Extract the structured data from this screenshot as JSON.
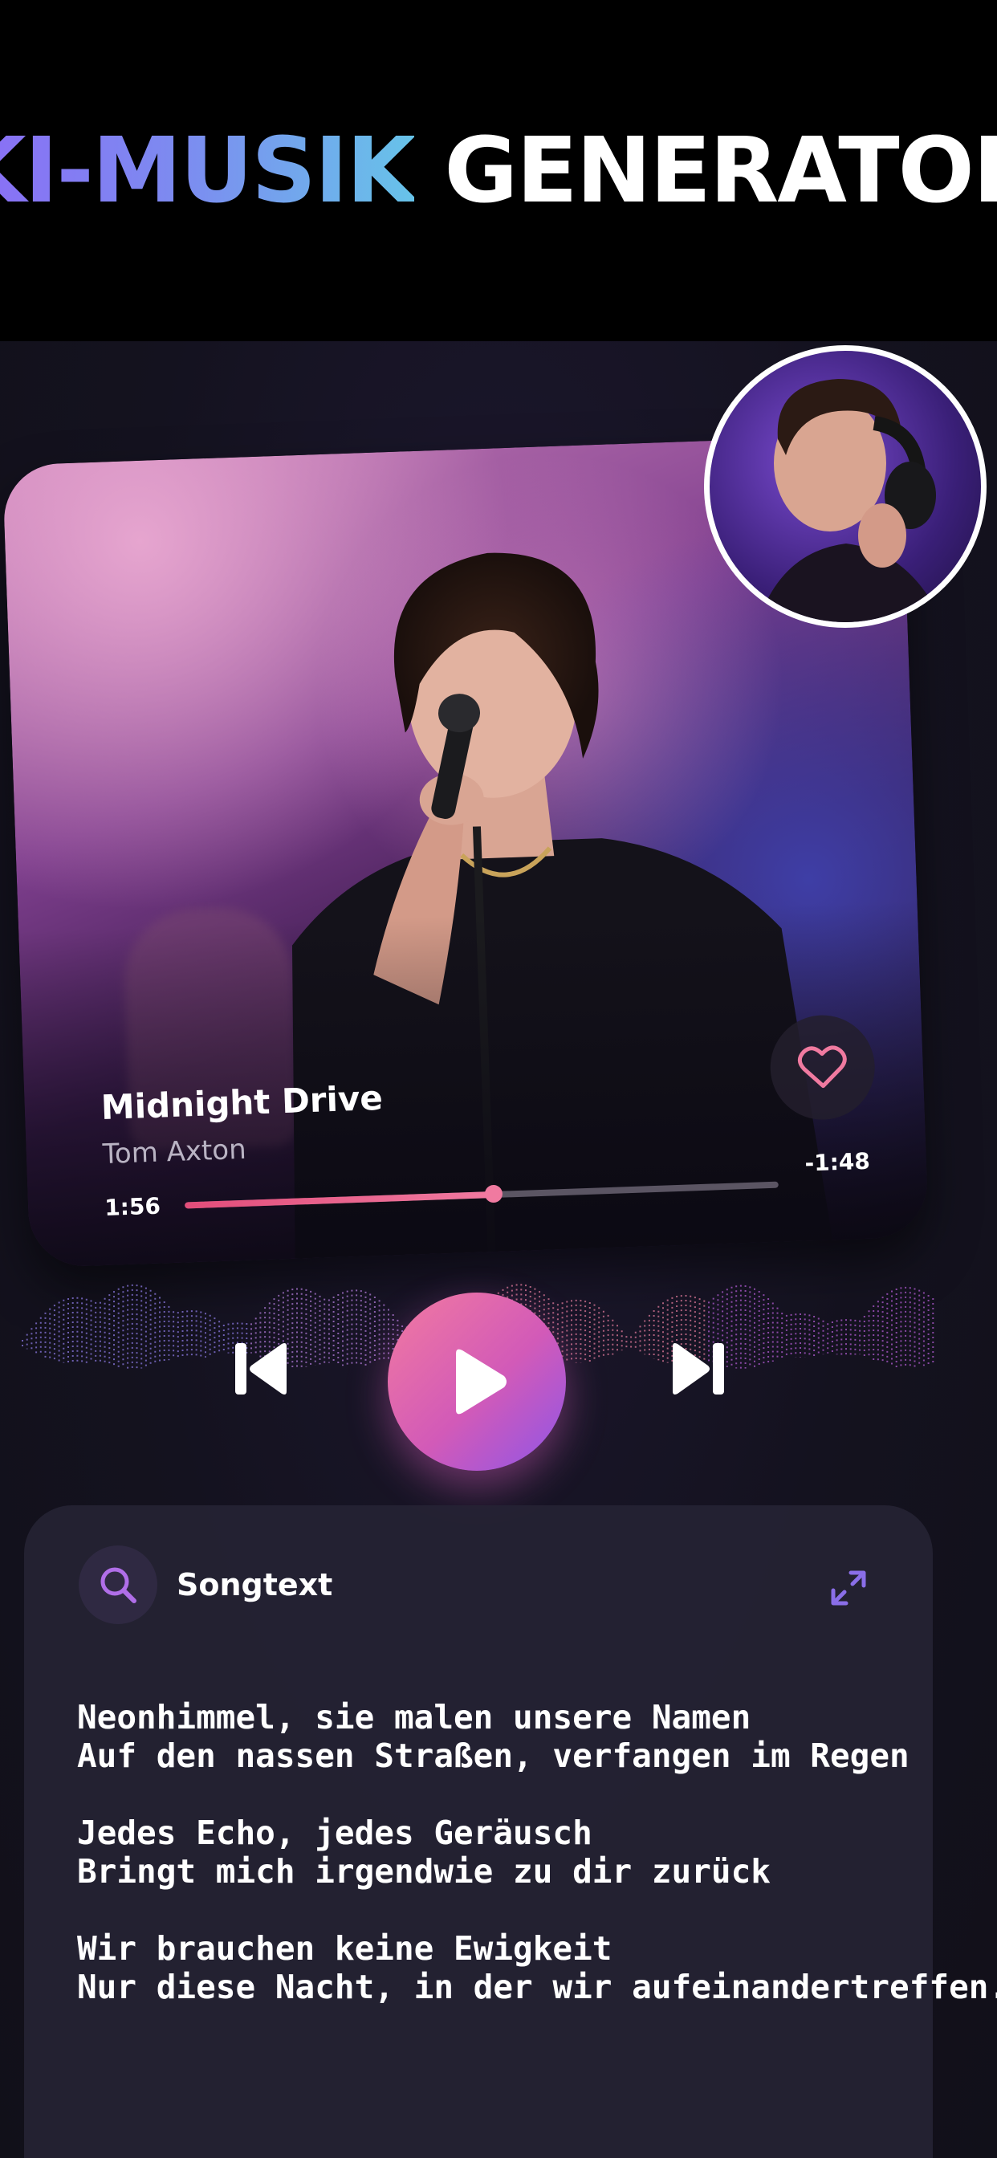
{
  "header": {
    "title_accent": "KI-MUSIK",
    "title_rest": "GENERATOR"
  },
  "player": {
    "song_title": "Midnight Drive",
    "artist": "Tom Axton",
    "elapsed": "1:56",
    "remaining": "-1:48",
    "progress_fraction": 0.52,
    "favorite_icon": "heart-outline-icon",
    "controls": [
      "skip-previous-icon",
      "play-icon",
      "skip-next-icon"
    ]
  },
  "lyrics": {
    "label": "Songtext",
    "stanzas": [
      [
        "Neonhimmel, sie malen unsere Namen",
        "Auf den nassen Straßen, verfangen im Regen"
      ],
      [
        "Jedes Echo, jedes Geräusch",
        "Bringt mich irgendwie zu dir zurück"
      ],
      [
        "Wir brauchen keine Ewigkeit",
        "Nur diese Nacht, in der wir aufeinandertreffen."
      ]
    ]
  },
  "colors": {
    "accent_pink": "#f07aa0",
    "accent_purple": "#8e55e8",
    "accent_blue": "#67c3e9"
  }
}
